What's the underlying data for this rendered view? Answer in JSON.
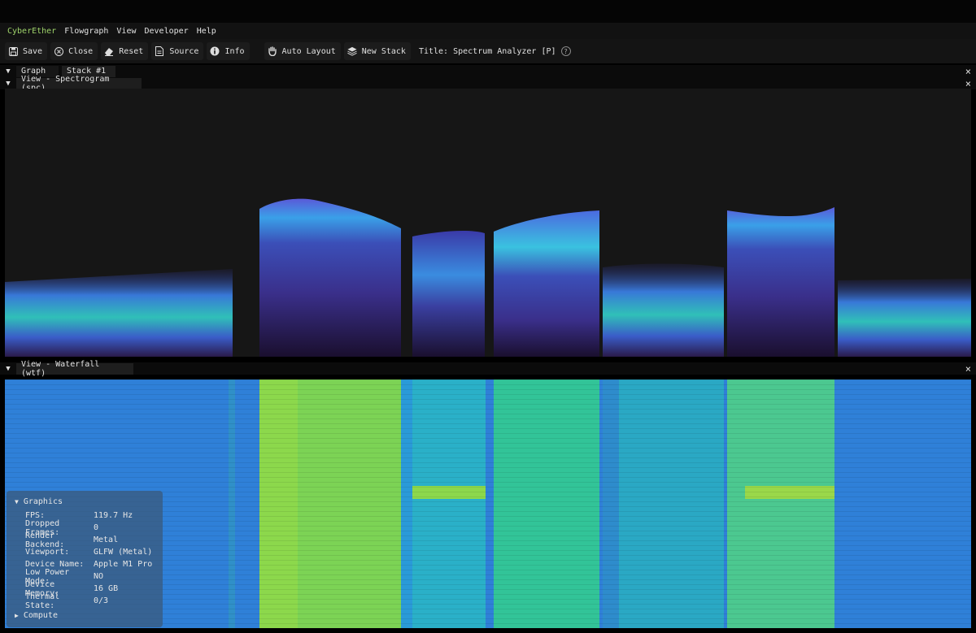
{
  "menu": {
    "brand": "CyberEther",
    "items": [
      "Flowgraph",
      "View",
      "Developer",
      "Help"
    ]
  },
  "toolbar": {
    "buttons": [
      "Save",
      "Close",
      "Reset",
      "Source",
      "Info"
    ],
    "auto_layout": "Auto Layout",
    "new_stack": "New Stack",
    "title": "Title: Spectrum Analyzer [P]",
    "help_icon_glyph": "?"
  },
  "tabs": {
    "top": [
      "Graph",
      "Stack #1"
    ],
    "spectrogram": "View - Spectrogram (spc)",
    "waterfall": "View - Waterfall (wtf)",
    "close_glyph": "×",
    "arrow_glyph": "▼"
  },
  "overlay": {
    "graphics_header": "Graphics",
    "rows": [
      {
        "k": "FPS:",
        "v": "119.7 Hz"
      },
      {
        "k": "Dropped Frames:",
        "v": "0"
      },
      {
        "k": "Render Backend:",
        "v": "Metal"
      },
      {
        "k": "Viewport:",
        "v": "GLFW (Metal)"
      },
      {
        "k": "Device Name:",
        "v": "Apple M1 Pro"
      },
      {
        "k": "Low Power Mode:",
        "v": "NO"
      },
      {
        "k": "Device Memory:",
        "v": "16 GB"
      },
      {
        "k": "Thermal State:",
        "v": "0/3"
      }
    ],
    "compute_header": "Compute",
    "expanded_glyph": "▼",
    "collapsed_glyph": "▶"
  },
  "colors": {
    "brand": "#9ed36a",
    "panel_bg": "#161616",
    "overlay_bg": "#3a5878"
  },
  "icons": [
    "save-icon",
    "close-circle-icon",
    "eraser-icon",
    "file-icon",
    "info-icon",
    "hand-icon",
    "stack-icon",
    "help-icon",
    "collapse-arrow-icon",
    "close-icon"
  ]
}
